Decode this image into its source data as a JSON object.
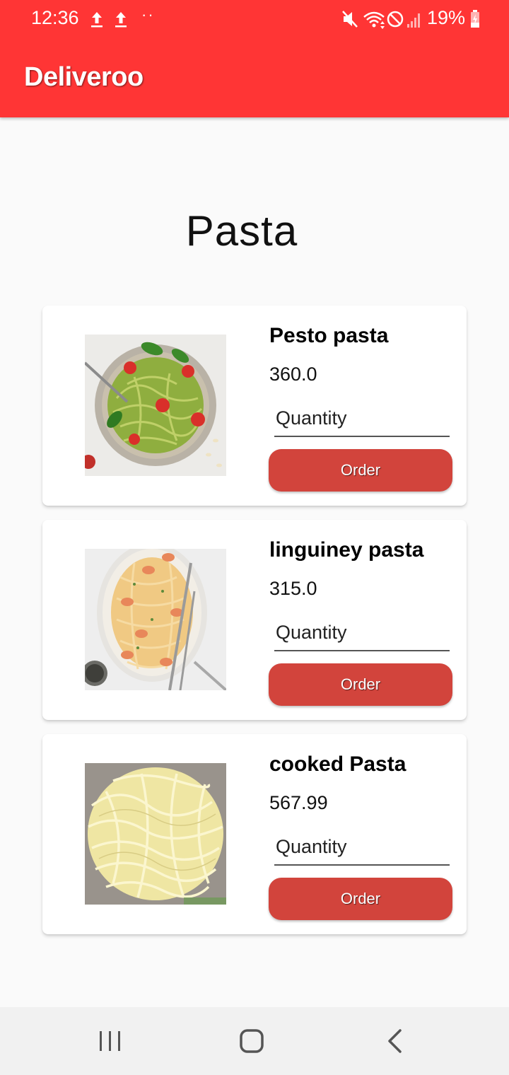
{
  "status_bar": {
    "time": "12:36",
    "dots": "··",
    "battery": "19%",
    "icons": [
      "upload-icon",
      "upload-icon",
      "mute-icon",
      "wifi-icon",
      "do-not-disturb-icon",
      "signal-icon",
      "battery-charging-icon"
    ]
  },
  "app_bar": {
    "title": "Deliveroo",
    "color": "#ff3535"
  },
  "page": {
    "heading": "Pasta"
  },
  "items": [
    {
      "name": "Pesto pasta",
      "price": "360.0",
      "quantity_placeholder": "Quantity",
      "quantity_value": "",
      "order_label": "Order"
    },
    {
      "name": "linguiney pasta",
      "price": "315.0",
      "quantity_placeholder": "Quantity",
      "quantity_value": "",
      "order_label": "Order"
    },
    {
      "name": "cooked Pasta",
      "price": "567.99",
      "quantity_placeholder": "Quantity",
      "quantity_value": "",
      "order_label": "Order"
    }
  ],
  "colors": {
    "accent": "#ff3535",
    "button": "#d2443c"
  },
  "nav_bar": {
    "icons": [
      "recent-apps-icon",
      "home-icon",
      "back-icon"
    ]
  }
}
